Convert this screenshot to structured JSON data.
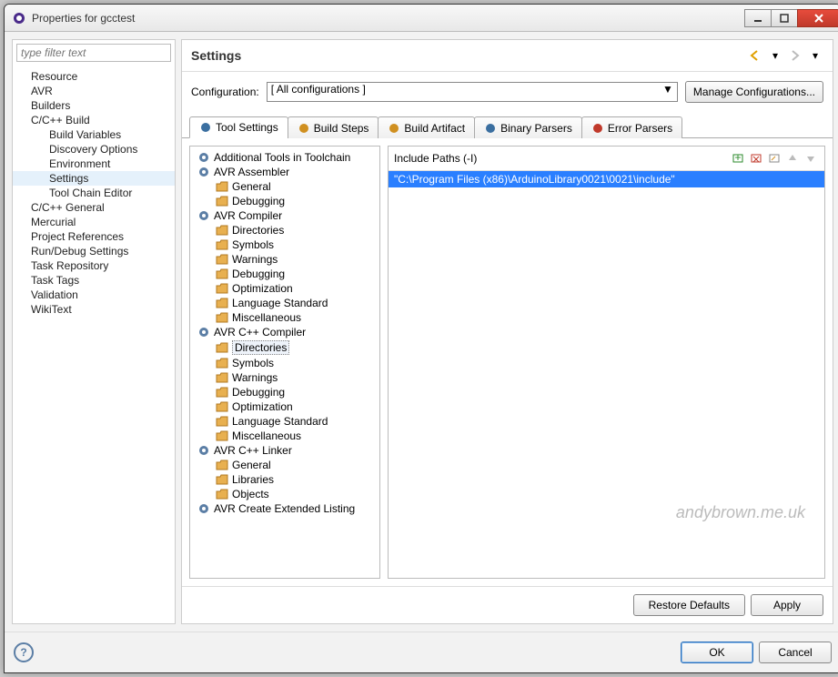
{
  "window": {
    "title": "Properties for gcctest"
  },
  "sidebar": {
    "filter_placeholder": "type filter text",
    "items": [
      {
        "label": "Resource",
        "lvl": 1
      },
      {
        "label": "AVR",
        "lvl": 1
      },
      {
        "label": "Builders",
        "lvl": 1
      },
      {
        "label": "C/C++ Build",
        "lvl": 1
      },
      {
        "label": "Build Variables",
        "lvl": 2
      },
      {
        "label": "Discovery Options",
        "lvl": 2
      },
      {
        "label": "Environment",
        "lvl": 2
      },
      {
        "label": "Settings",
        "lvl": 2,
        "selected": true
      },
      {
        "label": "Tool Chain Editor",
        "lvl": 2
      },
      {
        "label": "C/C++ General",
        "lvl": 1
      },
      {
        "label": "Mercurial",
        "lvl": 1
      },
      {
        "label": "Project References",
        "lvl": 1
      },
      {
        "label": "Run/Debug Settings",
        "lvl": 1
      },
      {
        "label": "Task Repository",
        "lvl": 1
      },
      {
        "label": "Task Tags",
        "lvl": 1
      },
      {
        "label": "Validation",
        "lvl": 1
      },
      {
        "label": "WikiText",
        "lvl": 1
      }
    ]
  },
  "main": {
    "title": "Settings",
    "config_label": "Configuration:",
    "config_value": "[ All configurations ]",
    "manage_label": "Manage Configurations...",
    "tabs": [
      {
        "label": "Tool Settings",
        "active": true
      },
      {
        "label": "Build Steps"
      },
      {
        "label": "Build Artifact"
      },
      {
        "label": "Binary Parsers"
      },
      {
        "label": "Error Parsers"
      }
    ],
    "tool_tree": [
      {
        "label": "Additional Tools in Toolchain",
        "type": "tool"
      },
      {
        "label": "AVR Assembler",
        "type": "tool"
      },
      {
        "label": "General",
        "type": "sub"
      },
      {
        "label": "Debugging",
        "type": "sub"
      },
      {
        "label": "AVR Compiler",
        "type": "tool"
      },
      {
        "label": "Directories",
        "type": "sub"
      },
      {
        "label": "Symbols",
        "type": "sub"
      },
      {
        "label": "Warnings",
        "type": "sub"
      },
      {
        "label": "Debugging",
        "type": "sub"
      },
      {
        "label": "Optimization",
        "type": "sub"
      },
      {
        "label": "Language Standard",
        "type": "sub"
      },
      {
        "label": "Miscellaneous",
        "type": "sub"
      },
      {
        "label": "AVR C++ Compiler",
        "type": "tool"
      },
      {
        "label": "Directories",
        "type": "sub",
        "selected": true
      },
      {
        "label": "Symbols",
        "type": "sub"
      },
      {
        "label": "Warnings",
        "type": "sub"
      },
      {
        "label": "Debugging",
        "type": "sub"
      },
      {
        "label": "Optimization",
        "type": "sub"
      },
      {
        "label": "Language Standard",
        "type": "sub"
      },
      {
        "label": "Miscellaneous",
        "type": "sub"
      },
      {
        "label": "AVR C++ Linker",
        "type": "tool"
      },
      {
        "label": "General",
        "type": "sub"
      },
      {
        "label": "Libraries",
        "type": "sub"
      },
      {
        "label": "Objects",
        "type": "sub"
      },
      {
        "label": "AVR Create Extended Listing",
        "type": "tool"
      }
    ],
    "include": {
      "title": "Include Paths (-I)",
      "items": [
        "\"C:\\Program Files (x86)\\ArduinoLibrary0021\\0021\\include\""
      ]
    },
    "restore_label": "Restore Defaults",
    "apply_label": "Apply",
    "ok_label": "OK",
    "cancel_label": "Cancel"
  },
  "watermark": "andybrown.me.uk"
}
